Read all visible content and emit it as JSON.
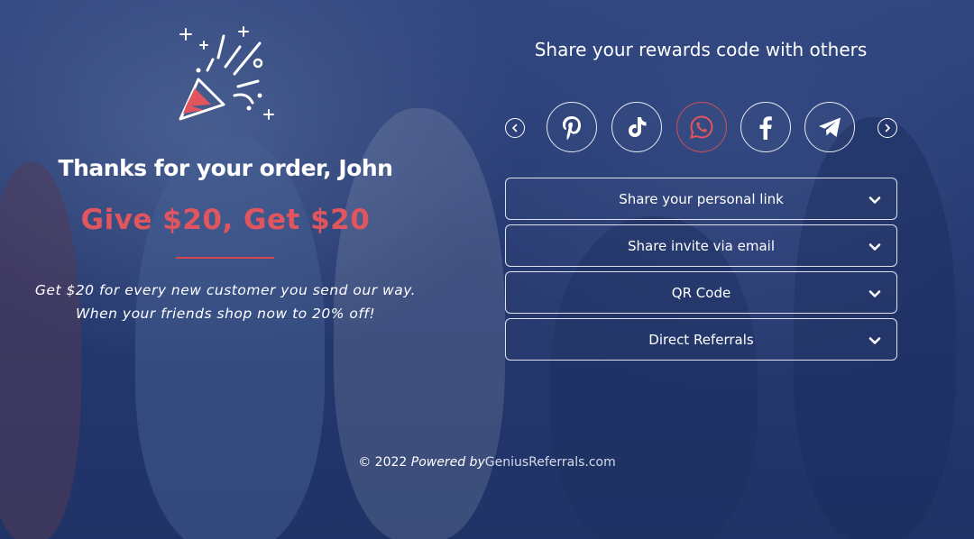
{
  "left": {
    "heading": "Thanks for your order, John",
    "offer": "Give $20, Get $20",
    "description_line1": "Get $20 for every new customer you send our way.",
    "description_line2": "When your friends shop now to 20% off!"
  },
  "share": {
    "title": "Share your rewards code with others",
    "social": [
      {
        "icon": "pinterest-icon"
      },
      {
        "icon": "tiktok-icon"
      },
      {
        "icon": "whatsapp-icon",
        "active": true
      },
      {
        "icon": "facebook-icon"
      },
      {
        "icon": "telegram-icon"
      }
    ],
    "options": [
      {
        "label": "Share your personal link"
      },
      {
        "label": "Share invite via email"
      },
      {
        "label": "QR Code"
      },
      {
        "label": "Direct Referrals"
      }
    ]
  },
  "footer": {
    "copyright": "© 2022",
    "powered": "Powered by",
    "brand": "GeniusReferrals.com"
  },
  "colors": {
    "accent_red": "#e0555e",
    "background": "#2a3f74"
  }
}
